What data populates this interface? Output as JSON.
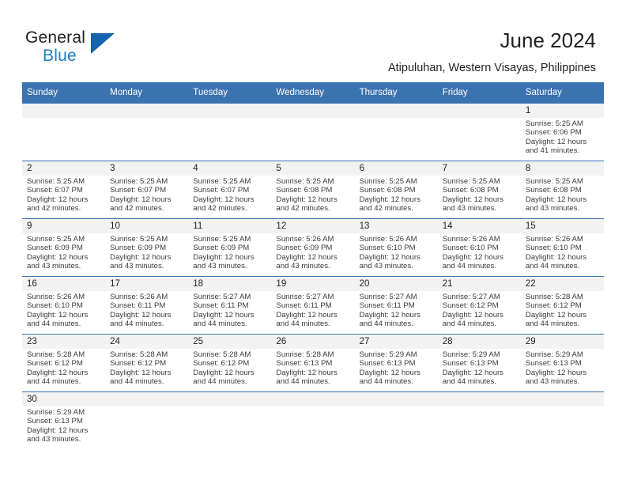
{
  "brand": {
    "name_top": "General",
    "name_bottom": "Blue"
  },
  "header": {
    "title": "June 2024",
    "subtitle": "Atipuluhan, Western Visayas, Philippines"
  },
  "colors": {
    "header_blue": "#3b72b0",
    "logo_blue": "#1c7fc4",
    "daynum_strip": "#f2f2f2"
  },
  "weekdays": [
    "Sunday",
    "Monday",
    "Tuesday",
    "Wednesday",
    "Thursday",
    "Friday",
    "Saturday"
  ],
  "weeks": [
    [
      {
        "day": "",
        "lines": []
      },
      {
        "day": "",
        "lines": []
      },
      {
        "day": "",
        "lines": []
      },
      {
        "day": "",
        "lines": []
      },
      {
        "day": "",
        "lines": []
      },
      {
        "day": "",
        "lines": []
      },
      {
        "day": "1",
        "lines": [
          "Sunrise: 5:25 AM",
          "Sunset: 6:06 PM",
          "Daylight: 12 hours",
          "and 41 minutes."
        ]
      }
    ],
    [
      {
        "day": "2",
        "lines": [
          "Sunrise: 5:25 AM",
          "Sunset: 6:07 PM",
          "Daylight: 12 hours",
          "and 42 minutes."
        ]
      },
      {
        "day": "3",
        "lines": [
          "Sunrise: 5:25 AM",
          "Sunset: 6:07 PM",
          "Daylight: 12 hours",
          "and 42 minutes."
        ]
      },
      {
        "day": "4",
        "lines": [
          "Sunrise: 5:25 AM",
          "Sunset: 6:07 PM",
          "Daylight: 12 hours",
          "and 42 minutes."
        ]
      },
      {
        "day": "5",
        "lines": [
          "Sunrise: 5:25 AM",
          "Sunset: 6:08 PM",
          "Daylight: 12 hours",
          "and 42 minutes."
        ]
      },
      {
        "day": "6",
        "lines": [
          "Sunrise: 5:25 AM",
          "Sunset: 6:08 PM",
          "Daylight: 12 hours",
          "and 42 minutes."
        ]
      },
      {
        "day": "7",
        "lines": [
          "Sunrise: 5:25 AM",
          "Sunset: 6:08 PM",
          "Daylight: 12 hours",
          "and 43 minutes."
        ]
      },
      {
        "day": "8",
        "lines": [
          "Sunrise: 5:25 AM",
          "Sunset: 6:08 PM",
          "Daylight: 12 hours",
          "and 43 minutes."
        ]
      }
    ],
    [
      {
        "day": "9",
        "lines": [
          "Sunrise: 5:25 AM",
          "Sunset: 6:09 PM",
          "Daylight: 12 hours",
          "and 43 minutes."
        ]
      },
      {
        "day": "10",
        "lines": [
          "Sunrise: 5:25 AM",
          "Sunset: 6:09 PM",
          "Daylight: 12 hours",
          "and 43 minutes."
        ]
      },
      {
        "day": "11",
        "lines": [
          "Sunrise: 5:25 AM",
          "Sunset: 6:09 PM",
          "Daylight: 12 hours",
          "and 43 minutes."
        ]
      },
      {
        "day": "12",
        "lines": [
          "Sunrise: 5:26 AM",
          "Sunset: 6:09 PM",
          "Daylight: 12 hours",
          "and 43 minutes."
        ]
      },
      {
        "day": "13",
        "lines": [
          "Sunrise: 5:26 AM",
          "Sunset: 6:10 PM",
          "Daylight: 12 hours",
          "and 43 minutes."
        ]
      },
      {
        "day": "14",
        "lines": [
          "Sunrise: 5:26 AM",
          "Sunset: 6:10 PM",
          "Daylight: 12 hours",
          "and 44 minutes."
        ]
      },
      {
        "day": "15",
        "lines": [
          "Sunrise: 5:26 AM",
          "Sunset: 6:10 PM",
          "Daylight: 12 hours",
          "and 44 minutes."
        ]
      }
    ],
    [
      {
        "day": "16",
        "lines": [
          "Sunrise: 5:26 AM",
          "Sunset: 6:10 PM",
          "Daylight: 12 hours",
          "and 44 minutes."
        ]
      },
      {
        "day": "17",
        "lines": [
          "Sunrise: 5:26 AM",
          "Sunset: 6:11 PM",
          "Daylight: 12 hours",
          "and 44 minutes."
        ]
      },
      {
        "day": "18",
        "lines": [
          "Sunrise: 5:27 AM",
          "Sunset: 6:11 PM",
          "Daylight: 12 hours",
          "and 44 minutes."
        ]
      },
      {
        "day": "19",
        "lines": [
          "Sunrise: 5:27 AM",
          "Sunset: 6:11 PM",
          "Daylight: 12 hours",
          "and 44 minutes."
        ]
      },
      {
        "day": "20",
        "lines": [
          "Sunrise: 5:27 AM",
          "Sunset: 6:11 PM",
          "Daylight: 12 hours",
          "and 44 minutes."
        ]
      },
      {
        "day": "21",
        "lines": [
          "Sunrise: 5:27 AM",
          "Sunset: 6:12 PM",
          "Daylight: 12 hours",
          "and 44 minutes."
        ]
      },
      {
        "day": "22",
        "lines": [
          "Sunrise: 5:28 AM",
          "Sunset: 6:12 PM",
          "Daylight: 12 hours",
          "and 44 minutes."
        ]
      }
    ],
    [
      {
        "day": "23",
        "lines": [
          "Sunrise: 5:28 AM",
          "Sunset: 6:12 PM",
          "Daylight: 12 hours",
          "and 44 minutes."
        ]
      },
      {
        "day": "24",
        "lines": [
          "Sunrise: 5:28 AM",
          "Sunset: 6:12 PM",
          "Daylight: 12 hours",
          "and 44 minutes."
        ]
      },
      {
        "day": "25",
        "lines": [
          "Sunrise: 5:28 AM",
          "Sunset: 6:12 PM",
          "Daylight: 12 hours",
          "and 44 minutes."
        ]
      },
      {
        "day": "26",
        "lines": [
          "Sunrise: 5:28 AM",
          "Sunset: 6:13 PM",
          "Daylight: 12 hours",
          "and 44 minutes."
        ]
      },
      {
        "day": "27",
        "lines": [
          "Sunrise: 5:29 AM",
          "Sunset: 6:13 PM",
          "Daylight: 12 hours",
          "and 44 minutes."
        ]
      },
      {
        "day": "28",
        "lines": [
          "Sunrise: 5:29 AM",
          "Sunset: 6:13 PM",
          "Daylight: 12 hours",
          "and 44 minutes."
        ]
      },
      {
        "day": "29",
        "lines": [
          "Sunrise: 5:29 AM",
          "Sunset: 6:13 PM",
          "Daylight: 12 hours",
          "and 43 minutes."
        ]
      }
    ],
    [
      {
        "day": "30",
        "lines": [
          "Sunrise: 5:29 AM",
          "Sunset: 6:13 PM",
          "Daylight: 12 hours",
          "and 43 minutes."
        ]
      },
      {
        "day": "",
        "lines": []
      },
      {
        "day": "",
        "lines": []
      },
      {
        "day": "",
        "lines": []
      },
      {
        "day": "",
        "lines": []
      },
      {
        "day": "",
        "lines": []
      },
      {
        "day": "",
        "lines": []
      }
    ]
  ]
}
